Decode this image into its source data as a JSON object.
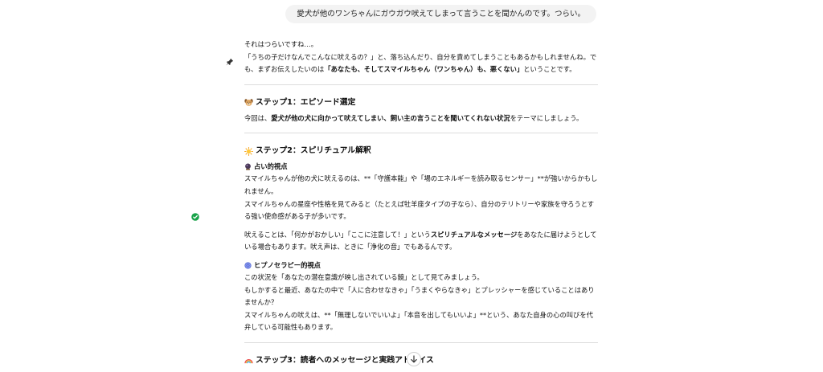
{
  "user_message": "愛犬が他のワンちゃんにガウガウ吠えてしまって言うことを聞かんのです。つらい。",
  "intro": {
    "line1": "それはつらいですね…。",
    "line2_a": "「うちの子だけなんでこんなに吠えるの？」と、落ち込んだり、自分を責めてしまうこともあるかもしれませんね。でも、まずお伝えしたいのは",
    "line2_bold": "「あなたも、そしてスマイルちゃん（ワンちゃん）も、悪くない」",
    "line2_b": "ということです。"
  },
  "step1": {
    "heading": "ステップ1：エピソード選定",
    "text_a": "今回は、",
    "text_bold": "愛犬が他の犬に向かって吠えてしまい、飼い主の言うことを聞いてくれない状況",
    "text_b": "をテーマにしましょう。"
  },
  "step2": {
    "heading": "ステップ2：スピリチュアル解釈",
    "fortune": {
      "subhead": "占い的視点",
      "p1": "スマイルちゃんが他の犬に吠えるのは、**「守護本能」や「場のエネルギーを読み取るセンサー」**が強いからかもしれません。",
      "p2": "スマイルちゃんの星座や性格を見てみると（たとえば牡羊座タイプの子なら）、自分のテリトリーや家族を守ろうとする強い使命感がある子が多いです。",
      "p3_a": "吠えることは、「何かがおかしい」「ここに注意して！」という",
      "p3_bold": "スピリチュアルなメッセージ",
      "p3_b": "をあなたに届けようとしている場合もあります。吠え声は、ときに「浄化の音」でもあるんです。"
    },
    "hypno": {
      "subhead": "ヒプノセラピー的視点",
      "p1": "この状況を「あなたの潜在意識が映し出されている鏡」として見てみましょう。",
      "p2": "もしかすると最近、あなたの中で「人に合わせなきゃ」「うまくやらなきゃ」とプレッシャーを感じていることはありませんか？",
      "p3": "スマイルちゃんの吠えは、**「無理しないでいいよ」「本音を出してもいいよ」**という、あなた自身の心の叫びを代弁している可能性もあります。"
    }
  },
  "step3": {
    "heading": "ステップ3：読者へのメッセージと実践アドバイス"
  },
  "icons": {
    "pin": "pin-icon",
    "check": "check-circle-icon",
    "dog": "dog-face-icon",
    "sun": "sun-icon",
    "crystal": "crystal-ball-icon",
    "hypno": "blue-circle-icon",
    "rainbow": "rainbow-icon",
    "scroll": "arrow-down-icon"
  },
  "colors": {
    "check": "#1aa34a",
    "divider": "#dcdcdc",
    "bubble": "#f3f3f3"
  }
}
